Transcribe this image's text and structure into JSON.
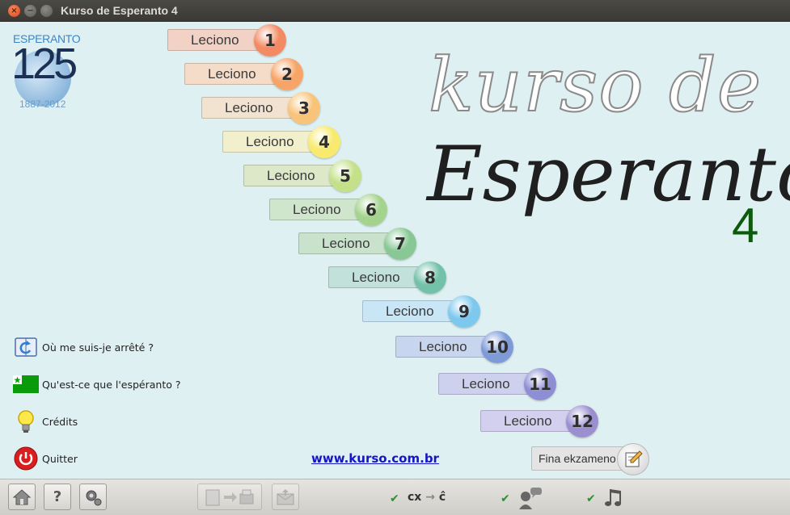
{
  "window": {
    "title": "Kurso de Esperanto 4"
  },
  "logo": {
    "top_text": "ESPERANTO",
    "number": "125",
    "years": "1887-2012"
  },
  "heading": {
    "line1": "kurso de",
    "line2": "Esperanto",
    "number": "4"
  },
  "lessons": [
    {
      "label": "Leciono",
      "num": "1",
      "color": "#f38a63",
      "box": "#f3d2c6"
    },
    {
      "label": "Leciono",
      "num": "2",
      "color": "#f7a468",
      "box": "#f5dcc8"
    },
    {
      "label": "Leciono",
      "num": "3",
      "color": "#f8c479",
      "box": "#f1e3cf"
    },
    {
      "label": "Leciono",
      "num": "4",
      "color": "#f8ea6f",
      "box": "#f2f0cc"
    },
    {
      "label": "Leciono",
      "num": "5",
      "color": "#c4e189",
      "box": "#dde8c9"
    },
    {
      "label": "Leciono",
      "num": "6",
      "color": "#a4d38e",
      "box": "#cfe6cd"
    },
    {
      "label": "Leciono",
      "num": "7",
      "color": "#88c895",
      "box": "#c8e2cc"
    },
    {
      "label": "Leciono",
      "num": "8",
      "color": "#72c1a8",
      "box": "#c2e1da"
    },
    {
      "label": "Leciono",
      "num": "9",
      "color": "#7cc8ee",
      "box": "#c8e6f6"
    },
    {
      "label": "Leciono",
      "num": "10",
      "color": "#7e9bd8",
      "box": "#c7d5ee"
    },
    {
      "label": "Leciono",
      "num": "11",
      "color": "#8d8ed3",
      "box": "#cdd1ee"
    },
    {
      "label": "Leciono",
      "num": "12",
      "color": "#9b8fd0",
      "box": "#d2d0ee"
    }
  ],
  "menu": {
    "resume": "Où me suis-je arrêté ?",
    "what": "Qu'est-ce que l'espéranto ?",
    "credits": "Crédits",
    "quit": "Quitter"
  },
  "url": "www.kurso.com.br",
  "final_exam": "Fina ekzameno",
  "toolbar": {
    "cx_label": "cx",
    "cx_arrow": "→",
    "cx_result": "ĉ",
    "check": "✔"
  }
}
